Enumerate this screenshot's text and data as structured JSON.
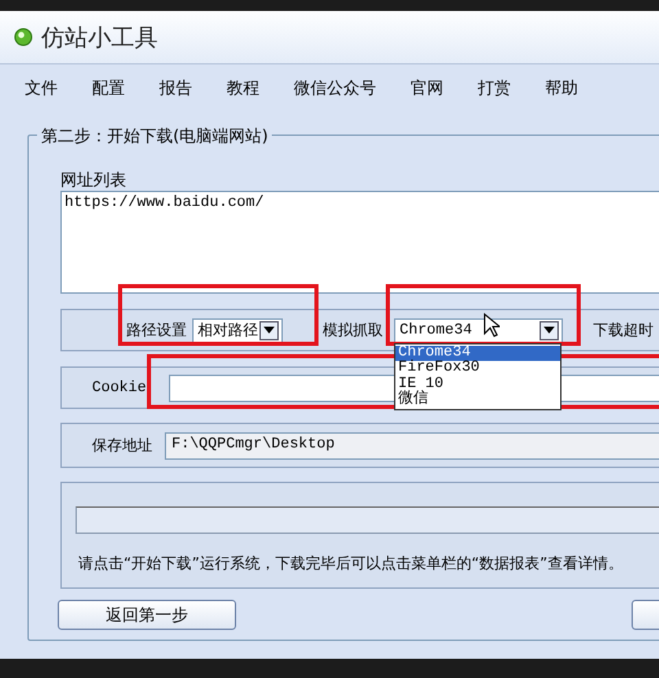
{
  "window": {
    "title": "仿站小工具"
  },
  "menu": [
    "文件",
    "配置",
    "报告",
    "教程",
    "微信公众号",
    "官网",
    "打赏",
    "帮助"
  ],
  "group": {
    "legend": "第二步：开始下载(电脑端网站)",
    "url_list": {
      "label": "网址列表",
      "value": "https://www.baidu.com/"
    },
    "path": {
      "label": "路径设置",
      "value": "相对路径"
    },
    "agent": {
      "label": "模拟抓取",
      "value": "Chrome34",
      "expanded": true,
      "options": [
        {
          "label": "Chrome34",
          "selected": true
        },
        {
          "label": "FireFox30",
          "selected": false
        },
        {
          "label": "IE 10",
          "selected": false
        },
        {
          "label": "微信",
          "selected": false
        }
      ]
    },
    "timeout": {
      "label": "下载超时"
    },
    "cookie": {
      "label": "Cookie"
    },
    "save": {
      "label": "保存地址",
      "value": "F:\\QQPCmgr\\Desktop"
    },
    "progress": {
      "level": 0
    },
    "message": "请点击“开始下载”运行系统，下载完毕后可以点击菜单栏的“数据报表”查看详情。",
    "buttons": [
      {
        "kind": "back",
        "label": "返回第一步"
      },
      {
        "kind": "next"
      }
    ]
  }
}
